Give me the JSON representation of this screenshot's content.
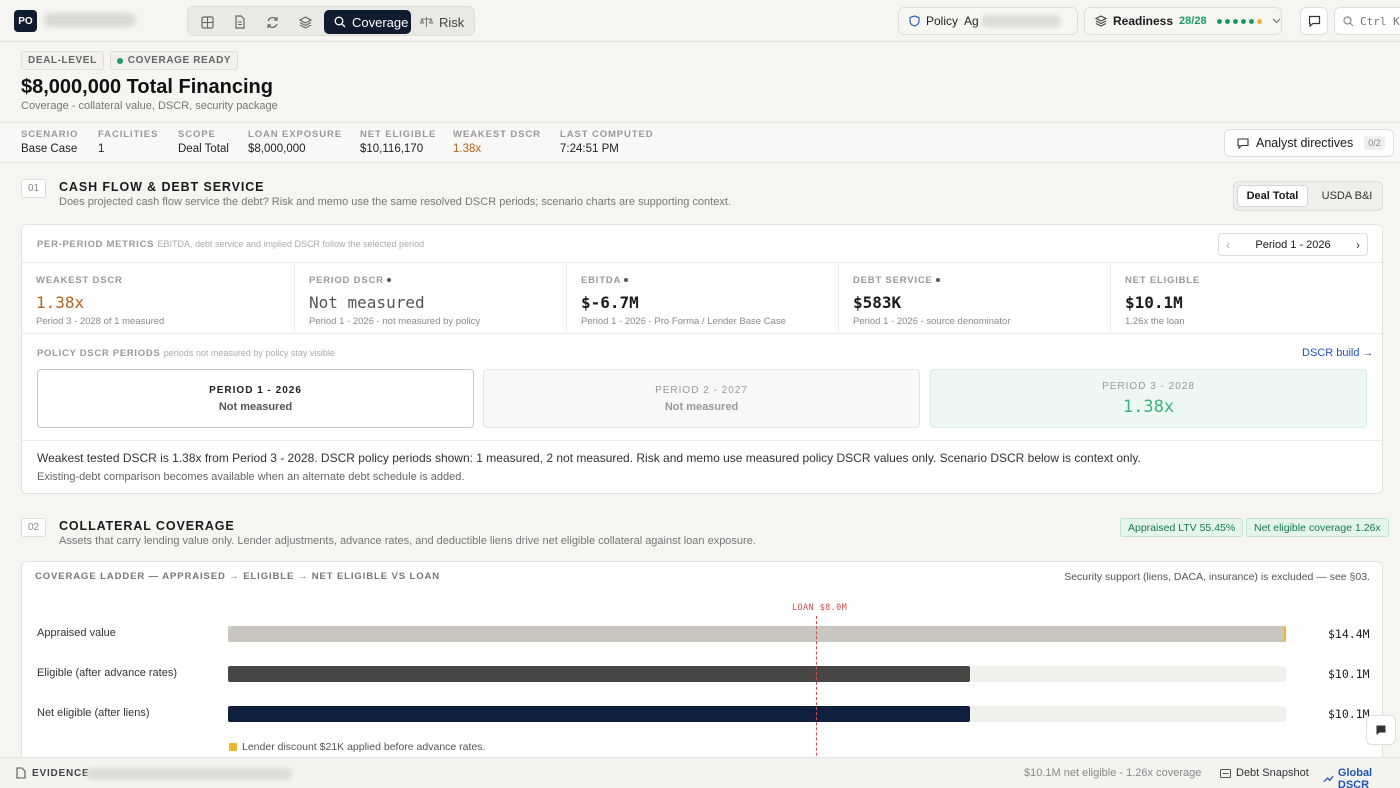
{
  "topbar": {
    "logo": "PO",
    "tabs": [
      {
        "name": "Coverage",
        "active": true
      },
      {
        "name": "Risk",
        "active": false
      }
    ],
    "policy_label": "Policy",
    "policy_value": "Ag",
    "readiness_label": "Readiness",
    "readiness_value": "28/28",
    "search_hint": "Ctrl K"
  },
  "header": {
    "badge_level": "DEAL-LEVEL",
    "badge_status": "COVERAGE READY",
    "title": "$8,000,000 Total Financing",
    "subtitle": "Coverage - collateral value, DSCR, security package"
  },
  "strip": {
    "items": [
      {
        "label": "SCENARIO",
        "value": "Base Case"
      },
      {
        "label": "FACILITIES",
        "value": "1"
      },
      {
        "label": "SCOPE",
        "value": "Deal Total"
      },
      {
        "label": "LOAN EXPOSURE",
        "value": "$8,000,000"
      },
      {
        "label": "NET ELIGIBLE",
        "value": "$10,116,170"
      },
      {
        "label": "WEAKEST DSCR",
        "value": "1.38x"
      },
      {
        "label": "LAST COMPUTED",
        "value": "7:24:51 PM"
      }
    ],
    "analyst_label": "Analyst directives",
    "analyst_count": "0/2"
  },
  "section1": {
    "num": "01",
    "title": "CASH FLOW & DEBT SERVICE",
    "subtitle": "Does projected cash flow service the debt? Risk and memo use the same resolved DSCR periods; scenario charts are supporting context.",
    "seg_a": "Deal Total",
    "seg_b": "USDA B&I",
    "card_head": "PER-PERIOD METRICS",
    "card_head_note": "EBITDA, debt service and implied DSCR follow the selected period",
    "pager_label": "Period 1 - 2026",
    "metrics": [
      {
        "label": "WEAKEST DSCR",
        "value": "1.38x",
        "note": "Period 3 - 2028 of 1 measured"
      },
      {
        "label": "PERIOD DSCR",
        "value": "Not measured",
        "note": "Period 1 - 2026 - not measured by policy"
      },
      {
        "label": "EBITDA",
        "value": "$-6.7M",
        "note": "Period 1 - 2026 - Pro Forma / Lender Base Case"
      },
      {
        "label": "DEBT SERVICE",
        "value": "$583K",
        "note": "Period 1 - 2026 - source denominator"
      },
      {
        "label": "NET ELIGIBLE",
        "value": "$10.1M",
        "note": "1.26x the loan"
      }
    ],
    "policy_head": "POLICY DSCR PERIODS",
    "policy_head_note": "periods not measured by policy stay visible",
    "dscr_link": "DSCR build →",
    "periods": [
      {
        "label": "PERIOD 1 - 2026",
        "value": "Not measured"
      },
      {
        "label": "PERIOD 2 - 2027",
        "value": "Not measured"
      },
      {
        "label": "PERIOD 3 - 2028",
        "value": "1.38x"
      }
    ],
    "summary": "Weakest tested DSCR is 1.38x from Period 3 - 2028. DSCR policy periods shown: 1 measured, 2 not measured. Risk and memo use measured policy DSCR values only. Scenario DSCR below is context only.",
    "summary2": "Existing-debt comparison becomes available when an alternate debt schedule is added."
  },
  "section2": {
    "num": "02",
    "title": "COLLATERAL COVERAGE",
    "subtitle": "Assets that carry lending value only. Lender adjustments, advance rates, and deductible liens drive net eligible collateral against loan exposure.",
    "tag_ltv": "Appraised LTV 55.45%",
    "tag_cov": "Net eligible coverage 1.26x",
    "card_head": "COVERAGE LADDER — APPRAISED → ELIGIBLE → NET ELIGIBLE VS LOAN",
    "card_note": "Security support (liens, DACA, insurance) is excluded — see §03.",
    "loan_label": "LOAN $8.0M",
    "scale_max": 14.4,
    "loan_value": 8.0,
    "rows": [
      {
        "label": "Appraised value",
        "value": 14.4,
        "display": "$14.4M",
        "color": "#c9c6bf"
      },
      {
        "label": "Eligible (after advance rates)",
        "value": 10.1,
        "display": "$10.1M",
        "color": "#474644"
      },
      {
        "label": "Net eligible (after liens)",
        "value": 10.1,
        "display": "$10.1M",
        "color": "#0f1f3d"
      }
    ],
    "discount_note": "Lender discount $21K applied before advance rates."
  },
  "footer": {
    "evidence_label": "EVIDENCE",
    "status": "$10.1M net eligible - 1.26x coverage",
    "snapshot": "Debt Snapshot",
    "global": "Global DSCR"
  },
  "colors": {
    "accent": "#0f1b2e",
    "warn": "#b3631a",
    "ok": "#1d9b63",
    "link": "#1f55b5"
  }
}
